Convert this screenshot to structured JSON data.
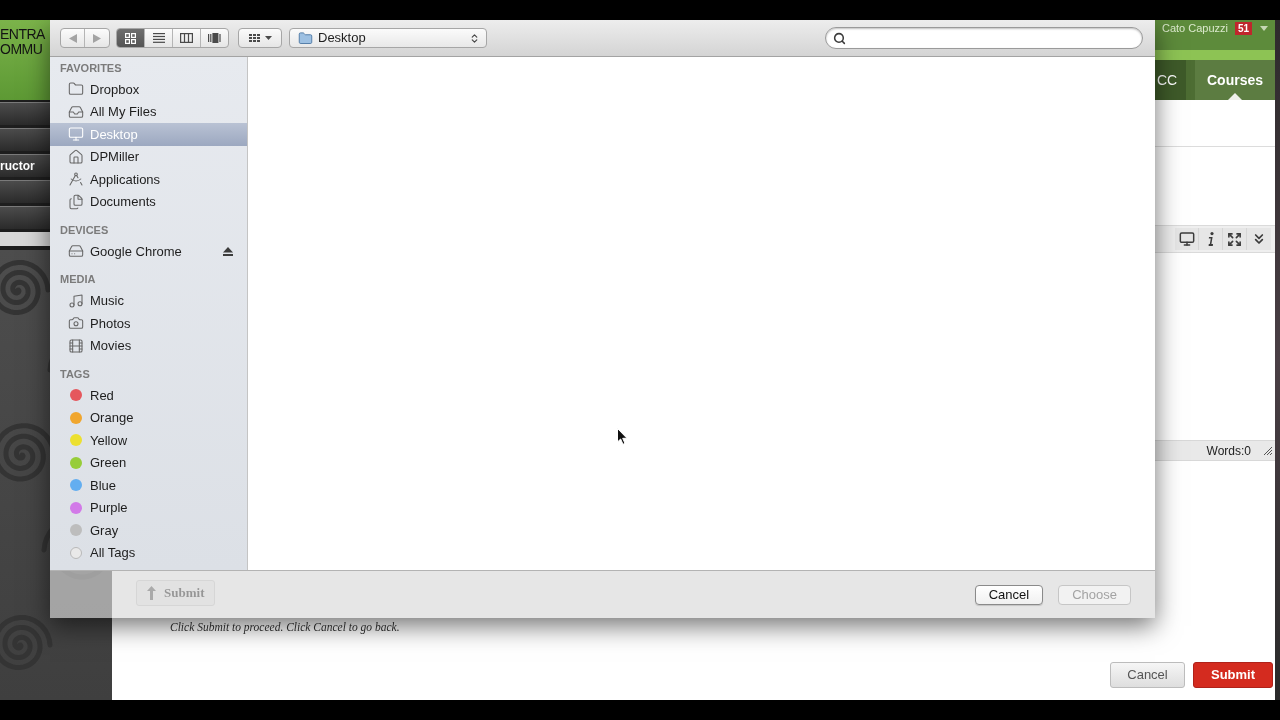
{
  "background_page": {
    "logo": [
      "ENTRA",
      "OMMU"
    ],
    "left_menu_label": "ructor",
    "user": {
      "name": "Cato Capuzzi",
      "badge": "51"
    },
    "nav_tabs": [
      {
        "label": "CC",
        "selected": false
      },
      {
        "label": "Courses",
        "selected": true
      }
    ],
    "editor": {
      "word_count": "Words:0"
    },
    "behind_dialog_button": "Submit",
    "instructions": "Click Submit to proceed. Click Cancel to go back.",
    "buttons": [
      {
        "label": "Cancel",
        "kind": "secondary"
      },
      {
        "label": "Submit",
        "kind": "primary"
      }
    ]
  },
  "dialog": {
    "toolbar": {
      "nav_buttons": [
        {
          "kind": "back",
          "disabled": true
        },
        {
          "kind": "forward",
          "disabled": true
        }
      ],
      "view_modes": [
        {
          "kind": "icons",
          "selected": true
        },
        {
          "kind": "list",
          "selected": false
        },
        {
          "kind": "columns",
          "selected": false
        },
        {
          "kind": "coverflow",
          "selected": false
        }
      ],
      "location": "Desktop"
    },
    "sidebar": {
      "sections": [
        {
          "heading": "FAVORITES",
          "items": [
            {
              "label": "Dropbox",
              "kind": "folder",
              "selected": false
            },
            {
              "label": "All My Files",
              "kind": "files",
              "selected": false
            },
            {
              "label": "Desktop",
              "kind": "desktop",
              "selected": true
            },
            {
              "label": "DPMiller",
              "kind": "home",
              "selected": false
            },
            {
              "label": "Applications",
              "kind": "apps",
              "selected": false
            },
            {
              "label": "Documents",
              "kind": "documents",
              "selected": false
            }
          ]
        },
        {
          "heading": "DEVICES",
          "items": [
            {
              "label": "Google Chrome",
              "kind": "drive",
              "selected": false,
              "ejectable": true
            }
          ]
        },
        {
          "heading": "MEDIA",
          "items": [
            {
              "label": "Music",
              "kind": "music",
              "selected": false
            },
            {
              "label": "Photos",
              "kind": "photos",
              "selected": false
            },
            {
              "label": "Movies",
              "kind": "movies",
              "selected": false
            }
          ]
        },
        {
          "heading": "TAGS",
          "items": [
            {
              "label": "Red",
              "kind": "tag",
              "color": "#e5575d",
              "selected": false
            },
            {
              "label": "Orange",
              "kind": "tag",
              "color": "#f0a62e",
              "selected": false
            },
            {
              "label": "Yellow",
              "kind": "tag",
              "color": "#ece030",
              "selected": false
            },
            {
              "label": "Green",
              "kind": "tag",
              "color": "#97cd38",
              "selected": false
            },
            {
              "label": "Blue",
              "kind": "tag",
              "color": "#63aef0",
              "selected": false
            },
            {
              "label": "Purple",
              "kind": "tag",
              "color": "#d27ae8",
              "selected": false
            },
            {
              "label": "Gray",
              "kind": "tag",
              "color": "#bdbdbd",
              "selected": false
            },
            {
              "label": "All Tags",
              "kind": "all_tags",
              "selected": false
            }
          ]
        }
      ]
    },
    "buttons": [
      {
        "label": "Cancel",
        "disabled": false
      },
      {
        "label": "Choose",
        "disabled": true
      }
    ]
  }
}
